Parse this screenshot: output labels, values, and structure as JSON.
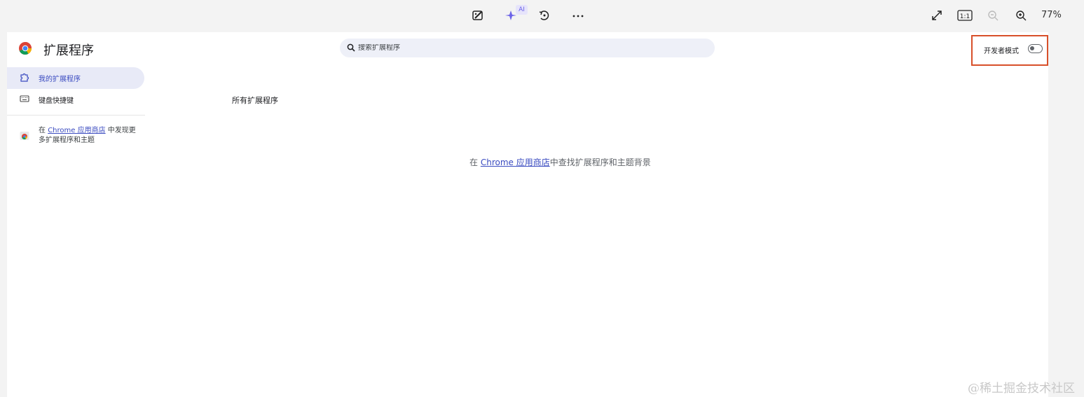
{
  "viewer": {
    "tools": [
      "edit-image",
      "ai-enhance",
      "rotate",
      "more"
    ],
    "ai_badge": "AI",
    "zoom": "77%",
    "actual_size_label": "1:1"
  },
  "header": {
    "title": "扩展程序",
    "search_placeholder": "搜索扩展程序",
    "dev_mode_label": "开发者模式",
    "dev_mode_on": false
  },
  "sidebar": {
    "items": [
      {
        "label": "我的扩展程序",
        "icon": "puzzle-icon",
        "active": true
      },
      {
        "label": "键盘快捷键",
        "icon": "keyboard-icon",
        "active": false
      }
    ],
    "promo": {
      "prefix": "在 ",
      "link": "Chrome 应用商店",
      "suffix": " 中发现更多扩展程序和主题"
    }
  },
  "main": {
    "section_title": "所有扩展程序",
    "empty": {
      "prefix": "在 ",
      "link": "Chrome 应用商店",
      "suffix": "中查找扩展程序和主题背景"
    }
  },
  "watermark": "@稀土掘金技术社区",
  "colors": {
    "accent": "#3a4bc0",
    "highlight_box": "#d8502a",
    "active_bg": "#e8eaf7"
  }
}
